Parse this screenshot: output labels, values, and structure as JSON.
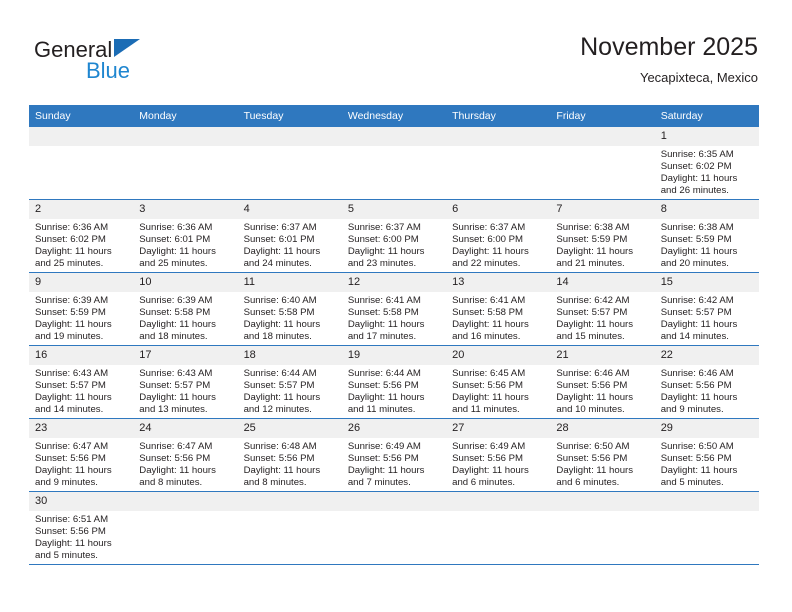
{
  "brand": {
    "name_top": "General",
    "name_bottom": "Blue",
    "accent_color": "#1f86d0",
    "triangle_color": "#1b6cb5",
    "logo_icon": "blue-triangle-flag-icon"
  },
  "header": {
    "month_title": "November 2025",
    "location": "Yecapixteca, Mexico"
  },
  "calendar": {
    "header_bg": "#2f78bf",
    "daynum_bg": "#f0f0f0",
    "weekday_headers": [
      "Sunday",
      "Monday",
      "Tuesday",
      "Wednesday",
      "Thursday",
      "Friday",
      "Saturday"
    ],
    "labels": {
      "sunrise": "Sunrise:",
      "sunset": "Sunset:",
      "daylight": "Daylight:"
    },
    "weeks": [
      [
        {
          "day": ""
        },
        {
          "day": ""
        },
        {
          "day": ""
        },
        {
          "day": ""
        },
        {
          "day": ""
        },
        {
          "day": ""
        },
        {
          "day": "1",
          "sunrise": "Sunrise: 6:35 AM",
          "sunset": "Sunset: 6:02 PM",
          "daylight_1": "Daylight: 11 hours",
          "daylight_2": "and 26 minutes."
        }
      ],
      [
        {
          "day": "2",
          "sunrise": "Sunrise: 6:36 AM",
          "sunset": "Sunset: 6:02 PM",
          "daylight_1": "Daylight: 11 hours",
          "daylight_2": "and 25 minutes."
        },
        {
          "day": "3",
          "sunrise": "Sunrise: 6:36 AM",
          "sunset": "Sunset: 6:01 PM",
          "daylight_1": "Daylight: 11 hours",
          "daylight_2": "and 25 minutes."
        },
        {
          "day": "4",
          "sunrise": "Sunrise: 6:37 AM",
          "sunset": "Sunset: 6:01 PM",
          "daylight_1": "Daylight: 11 hours",
          "daylight_2": "and 24 minutes."
        },
        {
          "day": "5",
          "sunrise": "Sunrise: 6:37 AM",
          "sunset": "Sunset: 6:00 PM",
          "daylight_1": "Daylight: 11 hours",
          "daylight_2": "and 23 minutes."
        },
        {
          "day": "6",
          "sunrise": "Sunrise: 6:37 AM",
          "sunset": "Sunset: 6:00 PM",
          "daylight_1": "Daylight: 11 hours",
          "daylight_2": "and 22 minutes."
        },
        {
          "day": "7",
          "sunrise": "Sunrise: 6:38 AM",
          "sunset": "Sunset: 5:59 PM",
          "daylight_1": "Daylight: 11 hours",
          "daylight_2": "and 21 minutes."
        },
        {
          "day": "8",
          "sunrise": "Sunrise: 6:38 AM",
          "sunset": "Sunset: 5:59 PM",
          "daylight_1": "Daylight: 11 hours",
          "daylight_2": "and 20 minutes."
        }
      ],
      [
        {
          "day": "9",
          "sunrise": "Sunrise: 6:39 AM",
          "sunset": "Sunset: 5:59 PM",
          "daylight_1": "Daylight: 11 hours",
          "daylight_2": "and 19 minutes."
        },
        {
          "day": "10",
          "sunrise": "Sunrise: 6:39 AM",
          "sunset": "Sunset: 5:58 PM",
          "daylight_1": "Daylight: 11 hours",
          "daylight_2": "and 18 minutes."
        },
        {
          "day": "11",
          "sunrise": "Sunrise: 6:40 AM",
          "sunset": "Sunset: 5:58 PM",
          "daylight_1": "Daylight: 11 hours",
          "daylight_2": "and 18 minutes."
        },
        {
          "day": "12",
          "sunrise": "Sunrise: 6:41 AM",
          "sunset": "Sunset: 5:58 PM",
          "daylight_1": "Daylight: 11 hours",
          "daylight_2": "and 17 minutes."
        },
        {
          "day": "13",
          "sunrise": "Sunrise: 6:41 AM",
          "sunset": "Sunset: 5:58 PM",
          "daylight_1": "Daylight: 11 hours",
          "daylight_2": "and 16 minutes."
        },
        {
          "day": "14",
          "sunrise": "Sunrise: 6:42 AM",
          "sunset": "Sunset: 5:57 PM",
          "daylight_1": "Daylight: 11 hours",
          "daylight_2": "and 15 minutes."
        },
        {
          "day": "15",
          "sunrise": "Sunrise: 6:42 AM",
          "sunset": "Sunset: 5:57 PM",
          "daylight_1": "Daylight: 11 hours",
          "daylight_2": "and 14 minutes."
        }
      ],
      [
        {
          "day": "16",
          "sunrise": "Sunrise: 6:43 AM",
          "sunset": "Sunset: 5:57 PM",
          "daylight_1": "Daylight: 11 hours",
          "daylight_2": "and 14 minutes."
        },
        {
          "day": "17",
          "sunrise": "Sunrise: 6:43 AM",
          "sunset": "Sunset: 5:57 PM",
          "daylight_1": "Daylight: 11 hours",
          "daylight_2": "and 13 minutes."
        },
        {
          "day": "18",
          "sunrise": "Sunrise: 6:44 AM",
          "sunset": "Sunset: 5:57 PM",
          "daylight_1": "Daylight: 11 hours",
          "daylight_2": "and 12 minutes."
        },
        {
          "day": "19",
          "sunrise": "Sunrise: 6:44 AM",
          "sunset": "Sunset: 5:56 PM",
          "daylight_1": "Daylight: 11 hours",
          "daylight_2": "and 11 minutes."
        },
        {
          "day": "20",
          "sunrise": "Sunrise: 6:45 AM",
          "sunset": "Sunset: 5:56 PM",
          "daylight_1": "Daylight: 11 hours",
          "daylight_2": "and 11 minutes."
        },
        {
          "day": "21",
          "sunrise": "Sunrise: 6:46 AM",
          "sunset": "Sunset: 5:56 PM",
          "daylight_1": "Daylight: 11 hours",
          "daylight_2": "and 10 minutes."
        },
        {
          "day": "22",
          "sunrise": "Sunrise: 6:46 AM",
          "sunset": "Sunset: 5:56 PM",
          "daylight_1": "Daylight: 11 hours",
          "daylight_2": "and 9 minutes."
        }
      ],
      [
        {
          "day": "23",
          "sunrise": "Sunrise: 6:47 AM",
          "sunset": "Sunset: 5:56 PM",
          "daylight_1": "Daylight: 11 hours",
          "daylight_2": "and 9 minutes."
        },
        {
          "day": "24",
          "sunrise": "Sunrise: 6:47 AM",
          "sunset": "Sunset: 5:56 PM",
          "daylight_1": "Daylight: 11 hours",
          "daylight_2": "and 8 minutes."
        },
        {
          "day": "25",
          "sunrise": "Sunrise: 6:48 AM",
          "sunset": "Sunset: 5:56 PM",
          "daylight_1": "Daylight: 11 hours",
          "daylight_2": "and 8 minutes."
        },
        {
          "day": "26",
          "sunrise": "Sunrise: 6:49 AM",
          "sunset": "Sunset: 5:56 PM",
          "daylight_1": "Daylight: 11 hours",
          "daylight_2": "and 7 minutes."
        },
        {
          "day": "27",
          "sunrise": "Sunrise: 6:49 AM",
          "sunset": "Sunset: 5:56 PM",
          "daylight_1": "Daylight: 11 hours",
          "daylight_2": "and 6 minutes."
        },
        {
          "day": "28",
          "sunrise": "Sunrise: 6:50 AM",
          "sunset": "Sunset: 5:56 PM",
          "daylight_1": "Daylight: 11 hours",
          "daylight_2": "and 6 minutes."
        },
        {
          "day": "29",
          "sunrise": "Sunrise: 6:50 AM",
          "sunset": "Sunset: 5:56 PM",
          "daylight_1": "Daylight: 11 hours",
          "daylight_2": "and 5 minutes."
        }
      ],
      [
        {
          "day": "30",
          "sunrise": "Sunrise: 6:51 AM",
          "sunset": "Sunset: 5:56 PM",
          "daylight_1": "Daylight: 11 hours",
          "daylight_2": "and 5 minutes."
        },
        {
          "day": ""
        },
        {
          "day": ""
        },
        {
          "day": ""
        },
        {
          "day": ""
        },
        {
          "day": ""
        },
        {
          "day": ""
        }
      ]
    ]
  }
}
